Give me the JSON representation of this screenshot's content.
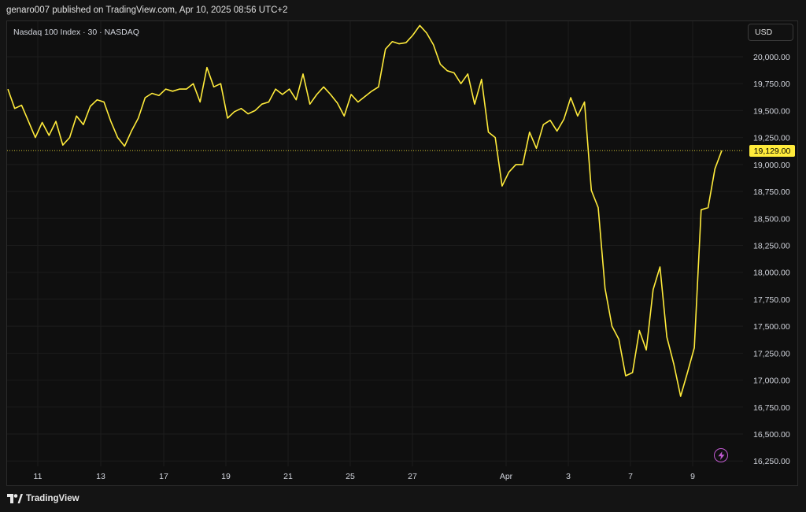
{
  "header": {
    "published_text": "genaro007 published on TradingView.com, Apr 10, 2025 08:56 UTC+2"
  },
  "legend": {
    "symbol": "Nasdaq 100 Index · 30 · NASDAQ"
  },
  "currency": "USD",
  "last_price_label": "19,129.00",
  "brand": "TradingView",
  "colors": {
    "line": "#ffeb3b",
    "price_tag_bg": "#ffeb3b",
    "background": "#0f0f0f",
    "grid": "#1c1c1c",
    "bolt": "#c05ad0"
  },
  "chart_data": {
    "type": "line",
    "title": "",
    "xlabel": "",
    "ylabel": "",
    "ylim": [
      16150,
      20120
    ],
    "last_price": 19129,
    "y_ticks": [
      20000,
      19750,
      19500,
      19250,
      19000,
      18750,
      18500,
      18250,
      18000,
      17750,
      17500,
      17250,
      17000,
      16750,
      16500,
      16250
    ],
    "y_tick_labels": [
      "20,000.00",
      "19,750.00",
      "19,500.00",
      "19,250.00",
      "19,000.00",
      "18,750.00",
      "18,500.00",
      "18,250.00",
      "18,000.00",
      "17,750.00",
      "17,500.00",
      "17,250.00",
      "17,000.00",
      "16,750.00",
      "16,500.00",
      "16,250.00"
    ],
    "x_ticks": [
      {
        "label": "11",
        "index": 4
      },
      {
        "label": "13",
        "index": 12
      },
      {
        "label": "17",
        "index": 20
      },
      {
        "label": "19",
        "index": 28
      },
      {
        "label": "21",
        "index": 36
      },
      {
        "label": "25",
        "index": 44
      },
      {
        "label": "27",
        "index": 52
      },
      {
        "label": "Apr",
        "index": 64
      },
      {
        "label": "3",
        "index": 72
      },
      {
        "label": "7",
        "index": 80
      },
      {
        "label": "9",
        "index": 88
      }
    ],
    "x_index_range": [
      0,
      92
    ],
    "series": [
      {
        "values": [
          [
            0,
            19700
          ],
          [
            1,
            19520
          ],
          [
            2,
            19550
          ],
          [
            3,
            19400
          ],
          [
            4,
            19250
          ],
          [
            5,
            19390
          ],
          [
            6,
            19270
          ],
          [
            7,
            19400
          ],
          [
            8,
            19180
          ],
          [
            9,
            19250
          ],
          [
            10,
            19450
          ],
          [
            11,
            19370
          ],
          [
            12,
            19540
          ],
          [
            13,
            19600
          ],
          [
            14,
            19580
          ],
          [
            15,
            19400
          ],
          [
            16,
            19250
          ],
          [
            17,
            19170
          ],
          [
            18,
            19310
          ],
          [
            19,
            19430
          ],
          [
            20,
            19620
          ],
          [
            21,
            19660
          ],
          [
            22,
            19640
          ],
          [
            23,
            19700
          ],
          [
            24,
            19680
          ],
          [
            25,
            19700
          ],
          [
            26,
            19700
          ],
          [
            27,
            19750
          ],
          [
            28,
            19580
          ],
          [
            29,
            19900
          ],
          [
            30,
            19720
          ],
          [
            31,
            19750
          ],
          [
            32,
            19430
          ],
          [
            33,
            19490
          ],
          [
            34,
            19520
          ],
          [
            35,
            19470
          ],
          [
            36,
            19500
          ],
          [
            37,
            19560
          ],
          [
            38,
            19580
          ],
          [
            39,
            19700
          ],
          [
            40,
            19650
          ],
          [
            41,
            19700
          ],
          [
            42,
            19600
          ],
          [
            43,
            19840
          ],
          [
            44,
            19560
          ],
          [
            45,
            19650
          ],
          [
            46,
            19720
          ],
          [
            47,
            19650
          ],
          [
            48,
            19570
          ],
          [
            49,
            19450
          ],
          [
            50,
            19650
          ],
          [
            51,
            19580
          ],
          [
            52,
            19630
          ],
          [
            53,
            19680
          ],
          [
            54,
            19720
          ],
          [
            55,
            20070
          ],
          [
            56,
            20140
          ],
          [
            57,
            20120
          ],
          [
            58,
            20130
          ],
          [
            59,
            20200
          ],
          [
            60,
            20290
          ],
          [
            61,
            20220
          ],
          [
            62,
            20110
          ],
          [
            63,
            19930
          ],
          [
            64,
            19870
          ],
          [
            65,
            19850
          ],
          [
            66,
            19750
          ],
          [
            67,
            19840
          ],
          [
            68,
            19560
          ],
          [
            69,
            19790
          ],
          [
            70,
            19300
          ],
          [
            71,
            19250
          ],
          [
            72,
            18800
          ],
          [
            73,
            18930
          ],
          [
            74,
            19000
          ],
          [
            75,
            19000
          ],
          [
            76,
            19300
          ],
          [
            77,
            19150
          ],
          [
            78,
            19370
          ],
          [
            79,
            19410
          ],
          [
            80,
            19310
          ],
          [
            81,
            19420
          ],
          [
            82,
            19620
          ],
          [
            83,
            19450
          ],
          [
            84,
            19580
          ],
          [
            85,
            18760
          ],
          [
            86,
            18600
          ],
          [
            87,
            17850
          ],
          [
            88,
            17500
          ],
          [
            89,
            17380
          ],
          [
            90,
            17040
          ],
          [
            91,
            17070
          ],
          [
            92,
            17460
          ],
          [
            93,
            17280
          ],
          [
            94,
            17840
          ],
          [
            95,
            18050
          ],
          [
            96,
            17400
          ],
          [
            97,
            17150
          ],
          [
            98,
            16850
          ],
          [
            99,
            17070
          ],
          [
            100,
            17300
          ],
          [
            101,
            18580
          ],
          [
            102,
            18600
          ],
          [
            103,
            18960
          ],
          [
            104,
            19129
          ]
        ]
      }
    ]
  }
}
